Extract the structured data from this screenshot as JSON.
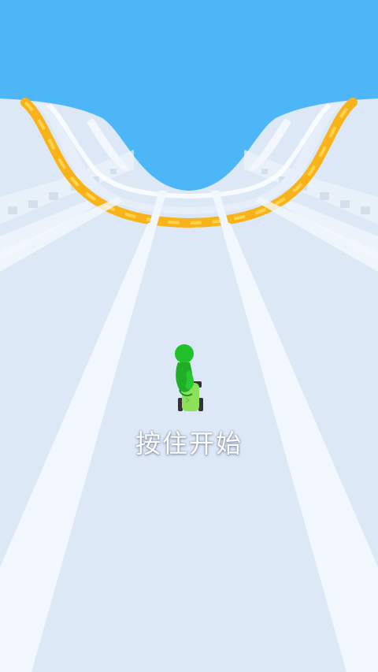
{
  "game": {
    "start_hint": "按住开始"
  },
  "colors": {
    "sky": "#4db6f7",
    "track": "#dce8f6",
    "track_lines": "#f2f7fd",
    "ramp_rail": "#f9b31a",
    "ramp_inner": "#e8f0fa",
    "player": "#22c02a",
    "skateboard": "#8ee05a"
  },
  "icons": {
    "player": "green-stickman-character",
    "board": "skateboard"
  }
}
